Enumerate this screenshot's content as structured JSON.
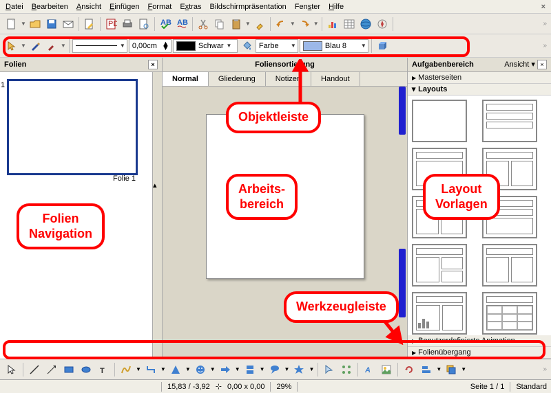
{
  "menu": {
    "items": [
      "Datei",
      "Bearbeiten",
      "Ansicht",
      "Einfügen",
      "Format",
      "Extras",
      "Bildschirmpräsentation",
      "Fenster",
      "Hilfe"
    ]
  },
  "obj": {
    "width_value": "0,00cm",
    "color1_name": "Schwar",
    "fill_label": "Farbe",
    "color2_name": "Blau 8"
  },
  "panels": {
    "left_title": "Folien",
    "slide_num": "1",
    "slide_label": "Folie 1",
    "center_title": "Foliensortierung",
    "tabs": [
      "Normal",
      "Gliederung",
      "Notizen",
      "Handout"
    ],
    "right_title": "Aufgabenbereich",
    "right_view": "Ansicht",
    "sections": {
      "master": "Masterseiten",
      "layouts": "Layouts",
      "anim": "Benutzerdefinierte Animation",
      "trans": "Folienübergang"
    }
  },
  "status": {
    "coords": "15,83 / -3,92",
    "size": "0,00 x 0,00",
    "zoom": "29%",
    "page": "Seite 1 / 1",
    "layout": "Standard"
  },
  "annotations": {
    "objektleiste": "Objektleiste",
    "arbeitsbereich": "Arbeits-\nbereich",
    "folien_nav": "Folien\nNavigation",
    "layout_vorlagen": "Layout\nVorlagen",
    "werkzeugleiste": "Werkzeugleiste"
  }
}
